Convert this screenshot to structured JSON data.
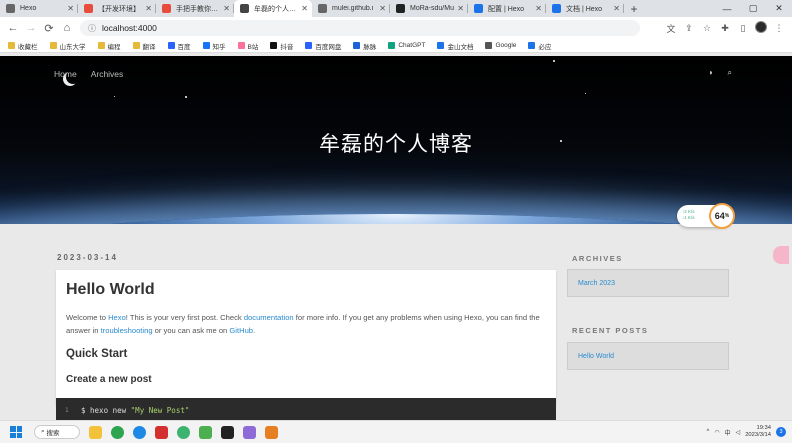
{
  "browser": {
    "tabs": [
      {
        "title": "Hexo",
        "color": "#666"
      },
      {
        "title": "【开发环境】",
        "color": "#e84c3d"
      },
      {
        "title": "手把手教你使用",
        "color": "#e84c3d"
      },
      {
        "title": "牟磊的个人博客",
        "color": "#444"
      },
      {
        "title": "mulei.github.i",
        "color": "#666"
      },
      {
        "title": "MoRa-sdu/Mu",
        "color": "#222"
      },
      {
        "title": "配置 | Hexo",
        "color": "#1a73e8"
      },
      {
        "title": "文档 | Hexo",
        "color": "#1a73e8"
      }
    ],
    "active_tab": 3,
    "url": "localhost:4000",
    "bookmarks": [
      {
        "label": "收藏栏",
        "color": "#e6b93a"
      },
      {
        "label": "山东大学",
        "color": "#e6b93a"
      },
      {
        "label": "编程",
        "color": "#e6b93a"
      },
      {
        "label": "翻译",
        "color": "#e6b93a"
      },
      {
        "label": "百度",
        "color": "#2962ff"
      },
      {
        "label": "知乎",
        "color": "#1772f6"
      },
      {
        "label": "B站",
        "color": "#fb7299"
      },
      {
        "label": "抖音",
        "color": "#111"
      },
      {
        "label": "百度网盘",
        "color": "#2962ff"
      },
      {
        "label": "脉脉",
        "color": "#1b61d8"
      },
      {
        "label": "ChatGPT",
        "color": "#10a37f"
      },
      {
        "label": "金山文档",
        "color": "#1a73e8"
      },
      {
        "label": "Google",
        "color": "#555"
      },
      {
        "label": "必应",
        "color": "#1a73e8"
      }
    ]
  },
  "site": {
    "nav": [
      "Home",
      "Archives"
    ],
    "title": "牟磊的个人博客"
  },
  "speed_widget": {
    "up": "↑2 K/s",
    "down": "↓1 K/s",
    "percent": "64",
    "percent_suffix": "%"
  },
  "post": {
    "date": "2023-03-14",
    "title": "Hello World",
    "p_1": "Welcome to ",
    "link_hexo": "Hexo",
    "p_2": "! This is your very first post. Check ",
    "link_docs": "documentation",
    "p_3": " for more info. If you get any problems when using Hexo, you can find the answer in ",
    "link_trouble": "troubleshooting",
    "p_4": " or you can ask me on ",
    "link_github": "GitHub",
    "p_5": ".",
    "h_quick": "Quick Start",
    "h_create": "Create a new post",
    "code_line": "1",
    "code_cmd": "$ hexo new ",
    "code_arg": "\"My New Post\""
  },
  "sidebar": {
    "archives_title": "ARCHIVES",
    "archives_item": "March 2023",
    "recent_title": "RECENT POSTS",
    "recent_item": "Hello World"
  },
  "taskbar": {
    "search": "搜索",
    "lang": "中",
    "time": "19:34",
    "date": "2023/3/14",
    "badge": "3"
  }
}
